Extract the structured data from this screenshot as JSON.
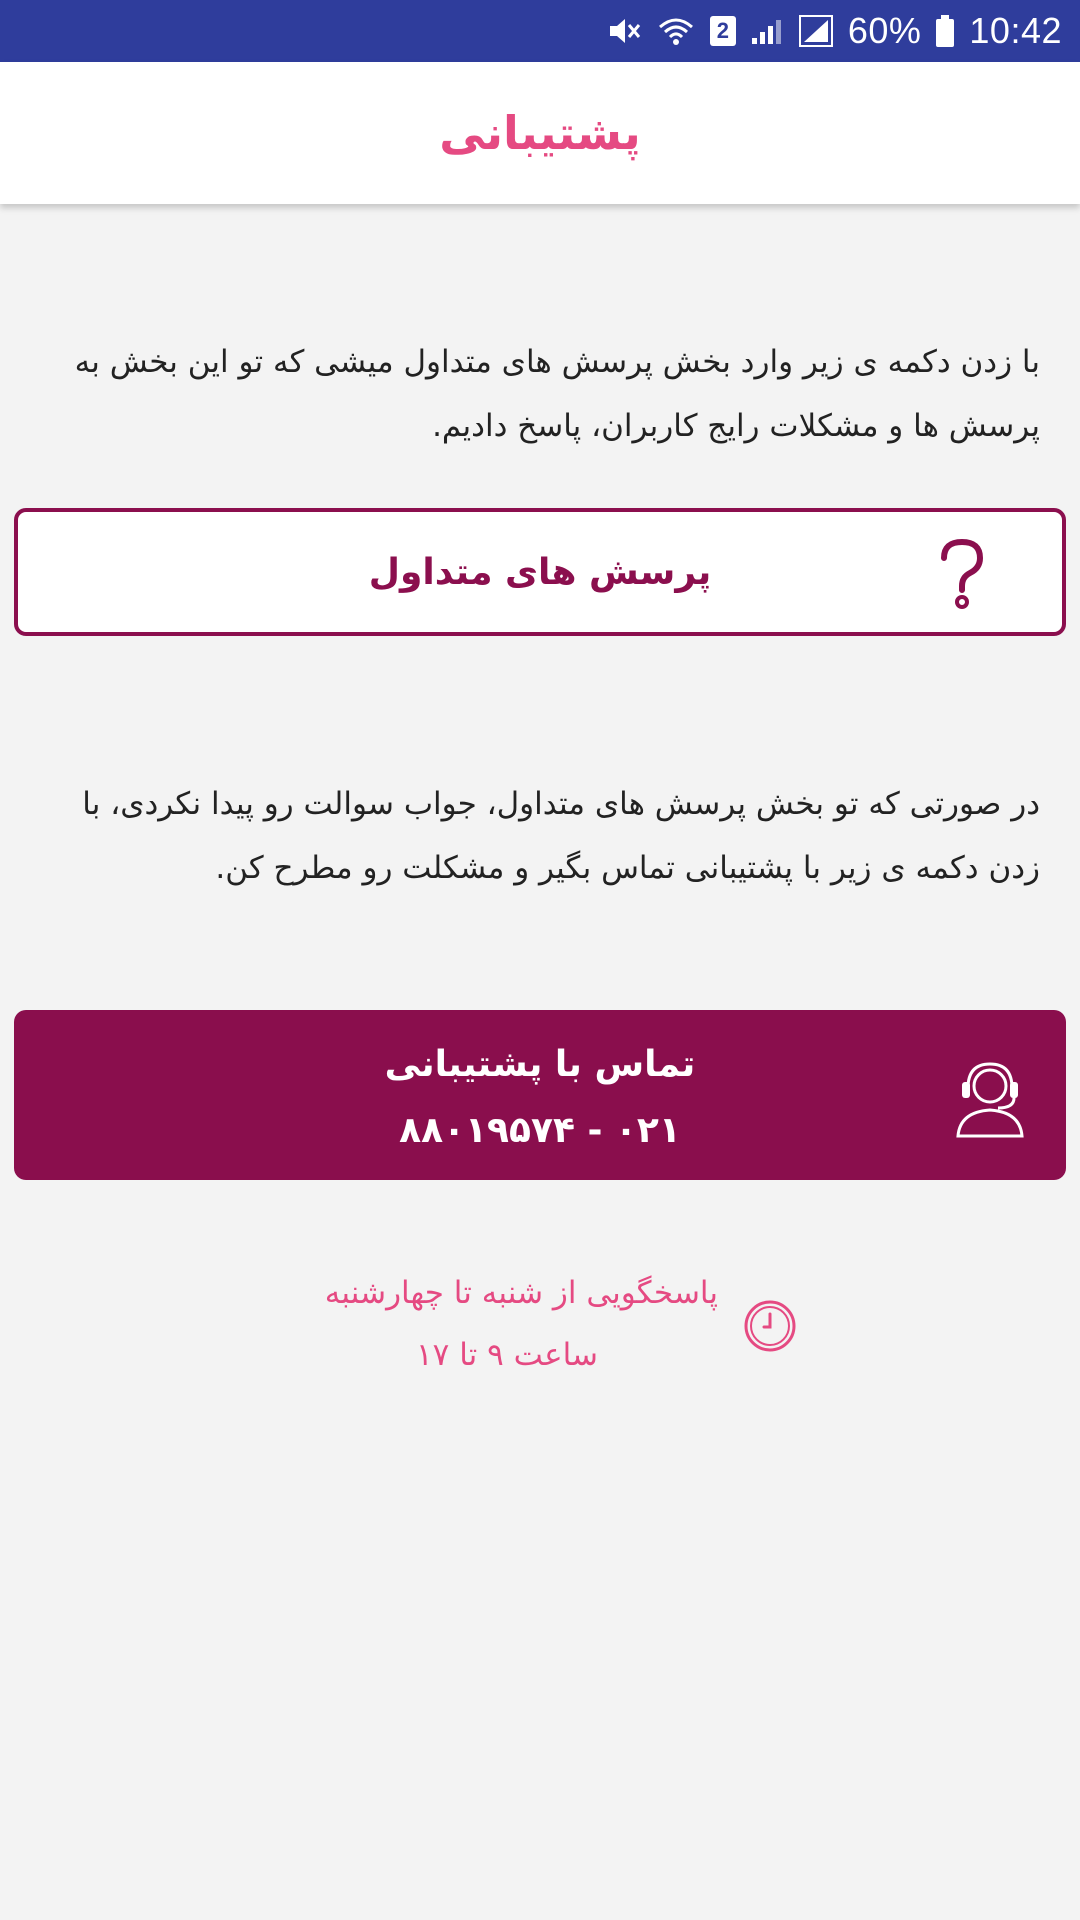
{
  "status_bar": {
    "battery": "60%",
    "time": "10:42",
    "sim_number": "2",
    "icons": [
      "mute-icon",
      "wifi-icon",
      "sim-icon",
      "signal-icon",
      "signal-icon",
      "battery-icon"
    ]
  },
  "app_bar": {
    "title": "پشتیبانی"
  },
  "faq_section": {
    "description": "با زدن دکمه ی زیر وارد بخش پرسش های متداول میشی که تو این بخش به پرسش ها و مشکلات رایج کاربران، پاسخ دادیم.",
    "button_label": "پرسش های متداول",
    "icon": "question-icon"
  },
  "contact_section": {
    "description": "در صورتی که تو بخش پرسش های متداول، جواب سوالت رو پیدا نکردی، با زدن دکمه ی زیر با پشتیبانی تماس بگیر و مشکلت رو مطرح کن.",
    "button_label": "تماس با پشتیبانی",
    "phone": "۰۲۱ - ۸۸۰۱۹۵۷۴",
    "icon": "support-agent-icon"
  },
  "hours": {
    "line1": "پاسخگویی از شنبه تا چهارشنبه",
    "line2": "ساعت ۹ تا ۱۷",
    "icon": "clock-icon"
  },
  "colors": {
    "status_bar": "#2f3d9c",
    "accent_pink": "#e54a82",
    "primary_maroon": "#8a0e4d",
    "background": "#f3f3f3"
  }
}
